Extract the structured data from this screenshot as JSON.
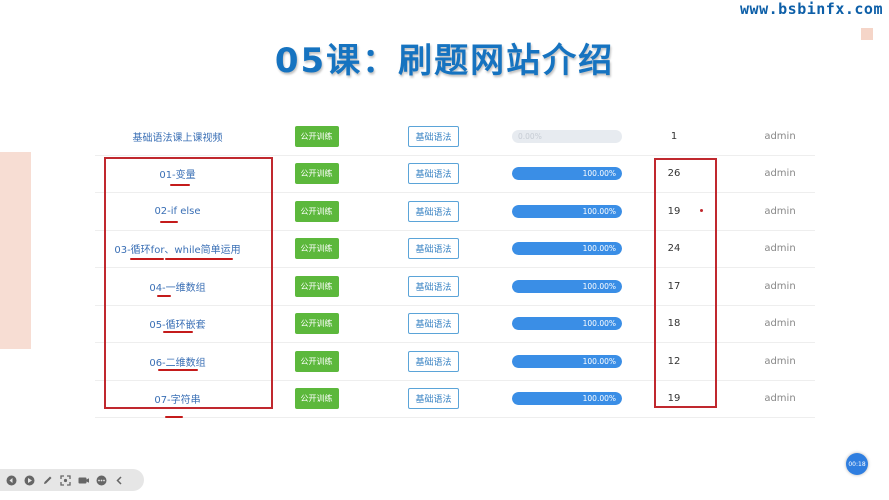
{
  "watermark": "www.bsbinfx.com",
  "title": "05课：刷题网站介绍",
  "rows": [
    {
      "name": "基础语法课上课视频",
      "button": "公开训练",
      "tag": "基础语法",
      "progress": 0,
      "progress_label": "0.00%",
      "count": "1",
      "user": "admin"
    },
    {
      "name": "01-变量",
      "button": "公开训练",
      "tag": "基础语法",
      "progress": 100,
      "progress_label": "100.00%",
      "count": "26",
      "user": "admin"
    },
    {
      "name": "02-if else",
      "button": "公开训练",
      "tag": "基础语法",
      "progress": 100,
      "progress_label": "100.00%",
      "count": "19",
      "user": "admin"
    },
    {
      "name": "03-循环for、while简单运用",
      "button": "公开训练",
      "tag": "基础语法",
      "progress": 100,
      "progress_label": "100.00%",
      "count": "24",
      "user": "admin"
    },
    {
      "name": "04-一维数组",
      "button": "公开训练",
      "tag": "基础语法",
      "progress": 100,
      "progress_label": "100.00%",
      "count": "17",
      "user": "admin"
    },
    {
      "name": "05-循环嵌套",
      "button": "公开训练",
      "tag": "基础语法",
      "progress": 100,
      "progress_label": "100.00%",
      "count": "18",
      "user": "admin"
    },
    {
      "name": "06-二维数组",
      "button": "公开训练",
      "tag": "基础语法",
      "progress": 100,
      "progress_label": "100.00%",
      "count": "12",
      "user": "admin"
    },
    {
      "name": "07-字符串",
      "button": "公开训练",
      "tag": "基础语法",
      "progress": 100,
      "progress_label": "100.00%",
      "count": "19",
      "user": "admin"
    }
  ],
  "toolbar": {
    "icons": [
      "prev-icon",
      "play-icon",
      "pen-icon",
      "capture-icon",
      "camera-icon",
      "more-icon",
      "collapse-icon"
    ]
  },
  "timer": "00:18",
  "colors": {
    "title": "#1673c0",
    "annotation": "#c0282e",
    "button": "#5cb83c",
    "progress": "#3a8ee6"
  }
}
